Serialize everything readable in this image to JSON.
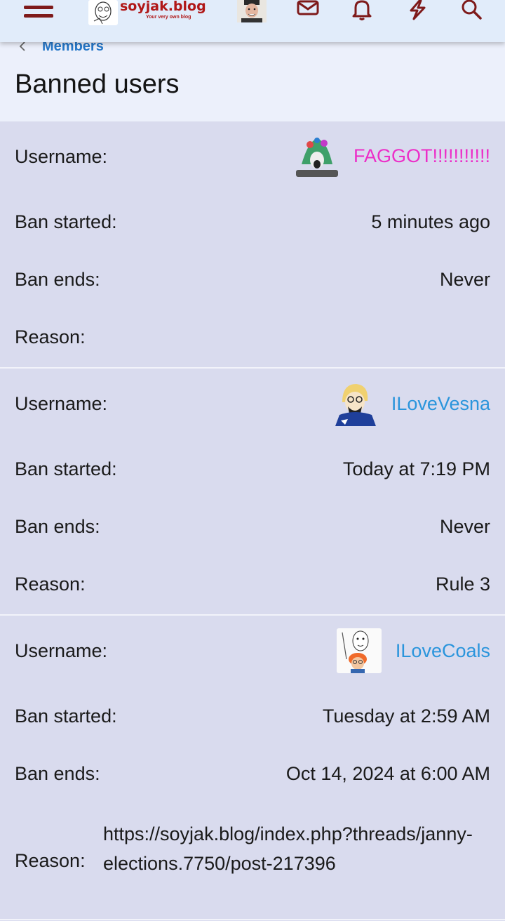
{
  "header": {
    "logo_text": "soyjak.blog",
    "logo_tagline": "Your very own blog",
    "icons": [
      "menu-icon",
      "envelope-icon",
      "bell-icon",
      "lightning-icon",
      "search-icon"
    ],
    "accent_color": "#7e1a1a"
  },
  "breadcrumb": {
    "label": "Members"
  },
  "page": {
    "title": "Banned users"
  },
  "labels": {
    "username": "Username:",
    "ban_started": "Ban started:",
    "ban_ends": "Ban ends:",
    "reason": "Reason:"
  },
  "bans": [
    {
      "username": "FAGGOT!!!!!!!!!!!",
      "username_color": "#ec2ec8",
      "ban_started": "5 minutes ago",
      "ban_ends": "Never",
      "reason": ""
    },
    {
      "username": "ILoveVesna",
      "username_color": "#2b95dc",
      "ban_started": "Today at 7:19 PM",
      "ban_ends": "Never",
      "reason": "Rule 3"
    },
    {
      "username": "ILoveCoals",
      "username_color": "#2b95dc",
      "ban_started": "Tuesday at 2:59 AM",
      "ban_ends": "Oct 14, 2024 at 6:00 AM",
      "reason": "https://soyjak.blog/index.php?threads/janny-elections.7750/post-217396"
    }
  ]
}
